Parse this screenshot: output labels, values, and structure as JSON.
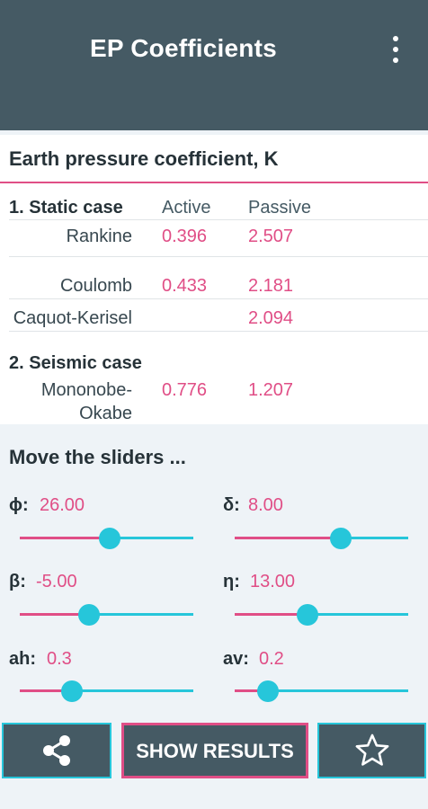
{
  "appbar": {
    "title": "EP Coefficients",
    "menu_icon": "more-vert-icon"
  },
  "results": {
    "title": "Earth pressure coefficient, K",
    "static_case": {
      "header": "1. Static case",
      "col_active": "Active",
      "col_passive": "Passive",
      "rows": [
        {
          "label": "Rankine",
          "active": "0.396",
          "passive": "2.507"
        },
        {
          "label": "Coulomb",
          "active": "0.433",
          "passive": "2.181"
        },
        {
          "label": "Caquot-Kerisel",
          "active": "",
          "passive": "2.094"
        }
      ]
    },
    "seismic_case": {
      "header": "2. Seismic case",
      "label_line1": "Mononobe-",
      "label_line2": "Okabe",
      "active": "0.776",
      "passive": "1.207"
    }
  },
  "sliders": {
    "title": "Move the sliders ...",
    "items": [
      {
        "label": "ϕ:",
        "value": "26.00",
        "level": 0.52
      },
      {
        "label": "δ:",
        "value": "8.00",
        "level": 0.61
      },
      {
        "label": "β:",
        "value": "-5.00",
        "level": 0.4
      },
      {
        "label": "η:",
        "value": "13.00",
        "level": 0.42
      },
      {
        "label": "ah:",
        "value": "0.3",
        "level": 0.3
      },
      {
        "label": "av:",
        "value": "0.2",
        "level": 0.19
      }
    ]
  },
  "buttons": {
    "share_icon": "share-icon",
    "show_results_label": "SHOW RESULTS",
    "favorite_icon": "star-outline-icon"
  },
  "colors": {
    "appbar": "#455a64",
    "accent_pink": "#e04e86",
    "accent_cyan": "#26c6da",
    "background": "#eef3f7"
  }
}
